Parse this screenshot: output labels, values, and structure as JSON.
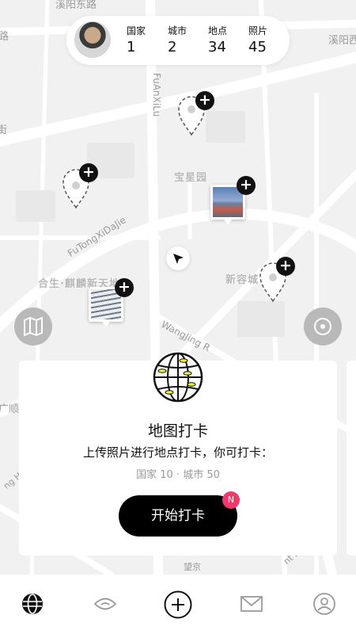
{
  "stats": {
    "items": [
      {
        "label": "国家",
        "value": "1"
      },
      {
        "label": "城市",
        "value": "2"
      },
      {
        "label": "地点",
        "value": "34"
      },
      {
        "label": "照片",
        "value": "45"
      }
    ]
  },
  "map": {
    "road_labels": [
      "溪阳东路",
      "FuAnXiLu",
      "FuTongXiDaJie",
      "WangJing R",
      "溪阳西",
      "路",
      "街",
      "广顺",
      "ng Hua",
      "nt Ex",
      "望京"
    ],
    "places": [
      "宝星园",
      "合生·麒麟新天地",
      "新容城"
    ]
  },
  "card": {
    "title": "地图打卡",
    "description": "上传照片进行地点打卡，你可打卡：",
    "subtitle": "国家 10 · 城市 50",
    "button_label": "开始打卡",
    "badge": "N"
  },
  "tabbar": {
    "icons": [
      "globe-icon",
      "eye-icon",
      "plus-circle-icon",
      "mail-icon",
      "profile-icon"
    ]
  },
  "colors": {
    "accent": "#000000",
    "badge": "#ef3a6b",
    "map_bg": "#f1f1f1"
  }
}
